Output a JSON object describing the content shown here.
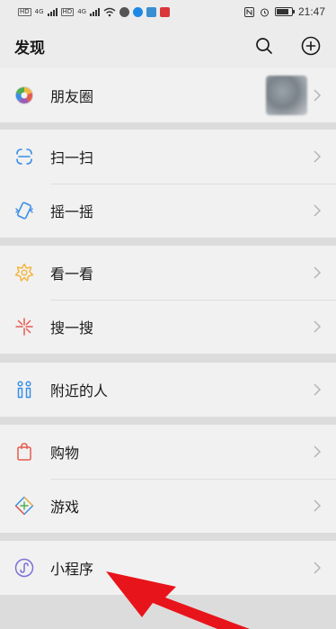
{
  "status_bar": {
    "left_indicators": [
      "HD",
      "4G",
      "HD",
      "4G"
    ],
    "time": "21:47"
  },
  "header": {
    "title": "发现",
    "icons": [
      "search-icon",
      "add-circle-icon"
    ]
  },
  "sections": [
    {
      "items": [
        {
          "label": "朋友圈",
          "icon": "moments-icon"
        }
      ]
    },
    {
      "items": [
        {
          "label": "扫一扫",
          "icon": "scan-icon"
        },
        {
          "label": "摇一摇",
          "icon": "shake-icon"
        }
      ]
    },
    {
      "items": [
        {
          "label": "看一看",
          "icon": "top-stories-icon"
        },
        {
          "label": "搜一搜",
          "icon": "search-sparkle-icon"
        }
      ]
    },
    {
      "items": [
        {
          "label": "附近的人",
          "icon": "people-nearby-icon"
        }
      ]
    },
    {
      "items": [
        {
          "label": "购物",
          "icon": "shopping-bag-icon"
        },
        {
          "label": "游戏",
          "icon": "games-icon"
        }
      ]
    },
    {
      "items": [
        {
          "label": "小程序",
          "icon": "mini-programs-icon"
        }
      ]
    }
  ],
  "colors": {
    "page_background": "#dcdcdc",
    "row_background": "#f1f1f1",
    "annotation_arrow": "#e8141b"
  }
}
